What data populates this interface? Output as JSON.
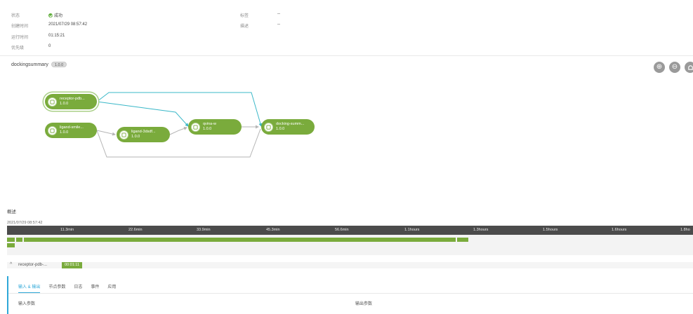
{
  "info": {
    "status_label": "状态",
    "status_value": "成功",
    "created_label": "创建时间",
    "created_value": "2021/07/29 08:57:42",
    "runtime_label": "运行时间",
    "runtime_value": "01:15:21",
    "priority_label": "优先级",
    "priority_value": "0",
    "tags_label": "标签",
    "tags_value": "--",
    "desc_label": "描述",
    "desc_value": "--"
  },
  "workflow": {
    "name": "dockingsummary",
    "version": "1.0.0"
  },
  "zoom_controls": {
    "zoom_in": "⊕",
    "zoom_out": "⊖"
  },
  "nodes": [
    {
      "name": "receptor-pdb...",
      "version": "1.0.0"
    },
    {
      "name": "ligand-smile...",
      "version": "1.0.0"
    },
    {
      "name": "ligand-3dsdf...",
      "version": "1.0.0"
    },
    {
      "name": "qvina-w",
      "version": "1.0.0"
    },
    {
      "name": "docking-summ...",
      "version": "1.0.0"
    }
  ],
  "overview": {
    "title": "概述",
    "start_time": "2021/07/29 08:57:42",
    "ticks": [
      "11.3min",
      "22.6min",
      "33.9min",
      "45.3min",
      "56.6min",
      "1.1hours",
      "1.3hours",
      "1.5hours",
      "1.6hours",
      "1.8ho"
    ]
  },
  "timeline_bars": [
    {
      "row": 0,
      "start": 0.0,
      "end": 0.011
    },
    {
      "row": 0,
      "start": 0.013,
      "end": 0.023
    },
    {
      "row": 0,
      "start": 0.025,
      "end": 0.654
    },
    {
      "row": 0,
      "start": 0.656,
      "end": 0.672
    },
    {
      "row": 1,
      "start": 0.0,
      "end": 0.011
    }
  ],
  "section": {
    "name": "receptor-pdb-...",
    "duration": "00:01:11"
  },
  "tabs": [
    "输入 & 输出",
    "节点参数",
    "日志",
    "事件",
    "应用"
  ],
  "io": {
    "input_label": "输入参数",
    "output_label": "输出参数"
  },
  "colors": {
    "accent": "#7aab3c",
    "link": "#2ea8d8",
    "edge_highlight": "#3bb8c8",
    "edge_default": "#b5b5b5"
  }
}
